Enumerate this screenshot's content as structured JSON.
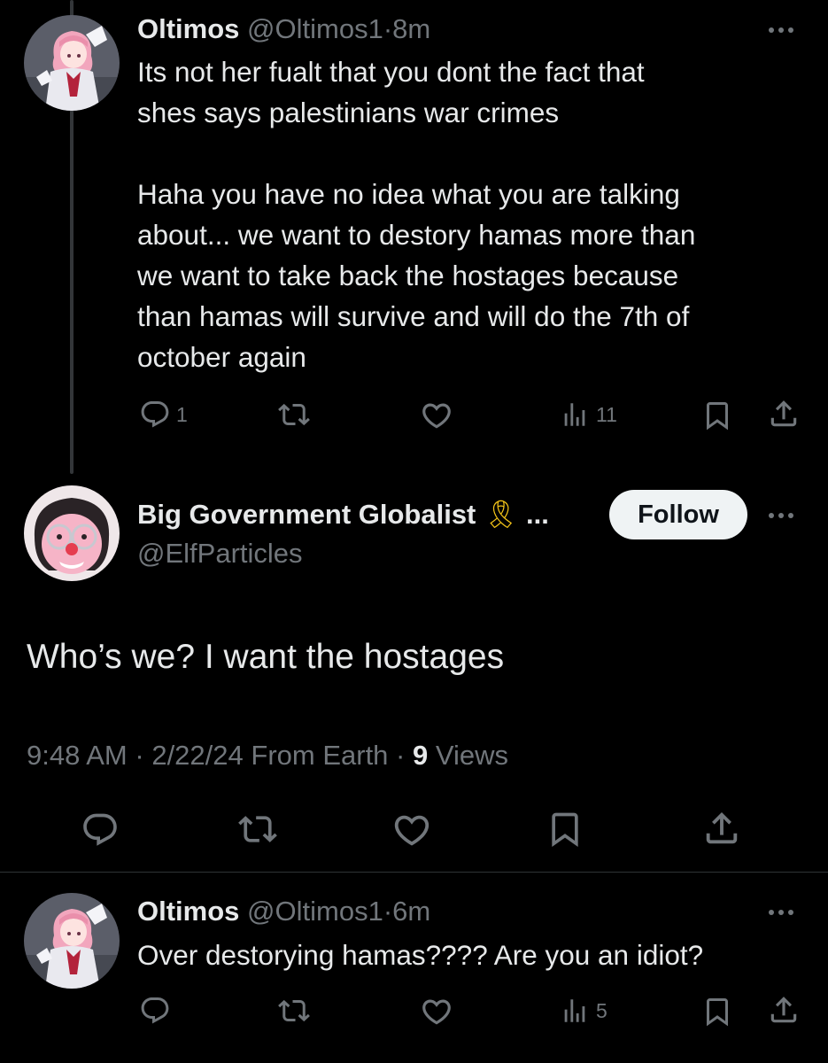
{
  "tweet1": {
    "display_name": "Oltimos",
    "handle": "@Oltimos1",
    "sep": "·",
    "time": "8m",
    "text": "Its not her fualt that you dont the fact that\nshes says palestinians war crimes\n\nHaha you have no idea what you are talking\nabout... we want to destory hamas more than\nwe want to take back the hostages because\nthan hamas will survive and will do the 7th of\noctober again",
    "reply_count": "1",
    "views_count": "11"
  },
  "main_tweet": {
    "display_name": "Big Government Globalist",
    "name_suffix": "...",
    "ribbon_emoji": "🎗",
    "handle": "@ElfParticles",
    "follow_label": "Follow",
    "text": "Who’s we? I want the hostages",
    "time": "9:48 AM",
    "sep": "·",
    "date": "2/22/24",
    "source": "From Earth",
    "views_count": "9",
    "views_label": "Views"
  },
  "tweet3": {
    "display_name": "Oltimos",
    "handle": "@Oltimos1",
    "sep": "·",
    "time": "6m",
    "text": "Over destorying hamas???? Are you an idiot?",
    "views_count": "5"
  },
  "icons": [
    "reply-icon",
    "retweet-icon",
    "like-icon",
    "views-icon",
    "bookmark-icon",
    "share-icon",
    "more-icon",
    "ribbon-icon"
  ],
  "colors": {
    "background": "#000000",
    "text": "#e7e9ea",
    "muted": "#71767b",
    "follow_bg": "#eff3f4",
    "ribbon": "#f5c518"
  }
}
